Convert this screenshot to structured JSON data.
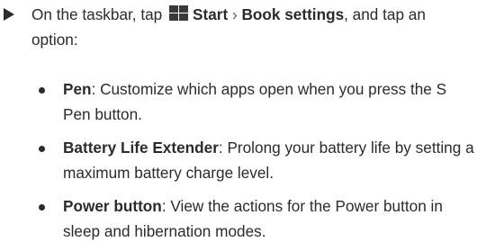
{
  "step": {
    "prefix": "On the taskbar, tap",
    "start_label": "Start",
    "separator": "›",
    "settings_label": "Book settings",
    "suffix": ", and tap an option:"
  },
  "options": [
    {
      "title": "Pen",
      "description": ": Customize which apps open when you press the S Pen button."
    },
    {
      "title": "Battery Life Extender",
      "description": ": Prolong your battery life by setting a maximum battery charge level."
    },
    {
      "title": "Power button",
      "description": ": View the actions for the Power button in sleep and hibernation modes."
    }
  ]
}
